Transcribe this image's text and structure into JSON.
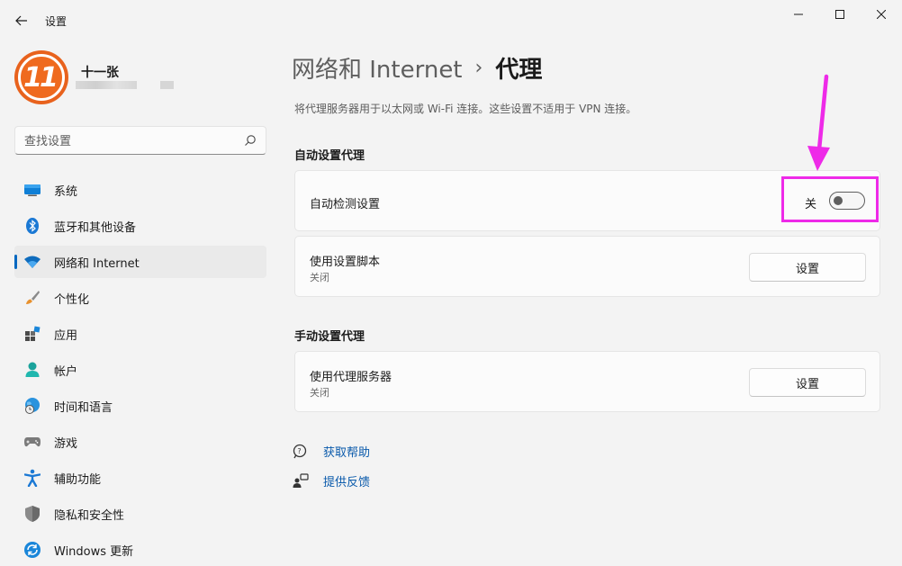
{
  "window": {
    "title": "设置"
  },
  "profile": {
    "avatar_text": "11",
    "name": "十一张"
  },
  "search": {
    "placeholder": "查找设置"
  },
  "sidebar": {
    "items": [
      {
        "label": "系统",
        "icon": "monitor-icon"
      },
      {
        "label": "蓝牙和其他设备",
        "icon": "bluetooth-icon"
      },
      {
        "label": "网络和 Internet",
        "icon": "wifi-icon",
        "active": true
      },
      {
        "label": "个性化",
        "icon": "brush-icon"
      },
      {
        "label": "应用",
        "icon": "apps-icon"
      },
      {
        "label": "帐户",
        "icon": "person-icon"
      },
      {
        "label": "时间和语言",
        "icon": "globe-clock-icon"
      },
      {
        "label": "游戏",
        "icon": "gamepad-icon"
      },
      {
        "label": "辅助功能",
        "icon": "accessibility-icon"
      },
      {
        "label": "隐私和安全性",
        "icon": "shield-icon"
      },
      {
        "label": "Windows 更新",
        "icon": "update-icon"
      }
    ]
  },
  "main": {
    "breadcrumb_parent": "网络和 Internet",
    "breadcrumb_sep": "›",
    "breadcrumb_current": "代理",
    "description": "将代理服务器用于以太网或 Wi-Fi 连接。这些设置不适用于 VPN 连接。",
    "auto_section": {
      "title": "自动设置代理",
      "auto_detect": {
        "title": "自动检测设置",
        "state_label": "关",
        "on": false
      },
      "setup_script": {
        "title": "使用设置脚本",
        "status": "关闭",
        "button": "设置"
      }
    },
    "manual_section": {
      "title": "手动设置代理",
      "proxy_server": {
        "title": "使用代理服务器",
        "status": "关闭",
        "button": "设置"
      }
    },
    "links": {
      "help": "获取帮助",
      "feedback": "提供反馈"
    }
  },
  "colors": {
    "accent": "#0067c0",
    "annotation": "#ee2ae8",
    "avatar": "#e8621d"
  }
}
